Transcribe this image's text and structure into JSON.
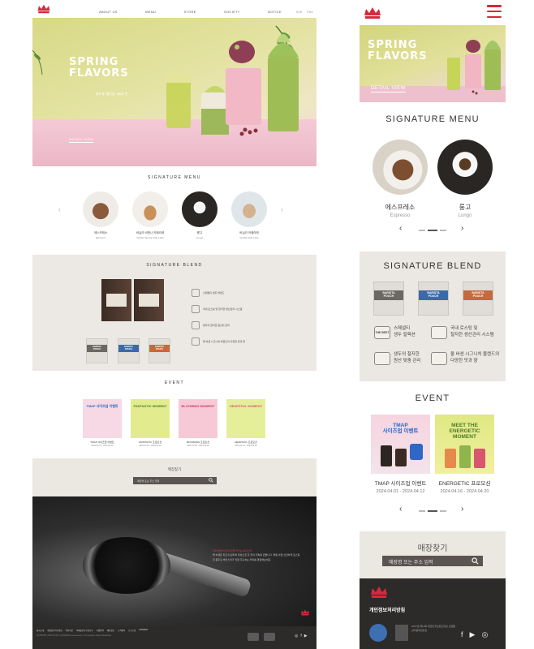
{
  "desktop": {
    "nav": [
      "ABOUT US",
      "MENU",
      "STORE",
      "SOCIETY",
      "NOTICE"
    ],
    "lang": [
      "KOR",
      "ENG"
    ],
    "hero": {
      "title_line1": "SPRING",
      "title_line2": "FLAVORS",
      "subtitle": "봄의 향기를 담은 새로운 맛",
      "detail": "DETAIL VIEW"
    },
    "signature_menu": {
      "title": "SIGNATURE MENU",
      "items": [
        {
          "name": "에스프레소",
          "eng": "Espresso"
        },
        {
          "name": "바닐라 비엔나 카페라떼",
          "eng": "Vanilla Vienna Cafe Latte"
        },
        {
          "name": "룽고",
          "eng": "Lungo"
        },
        {
          "name": "바닐라 카페라떼",
          "eng": "Vanilla Cafe Latte"
        }
      ]
    },
    "signature_blend": {
      "title": "SIGNATURE BLEND",
      "features": [
        "스페셜티 생두 블렌드",
        "국내 로스팅 및 철저한 생산관리 시스템",
        "생두의 철저한 원산지 관리",
        "올 바센 시그니처 블렌드의 다양한 맛과 향"
      ]
    },
    "event": {
      "title": "EVENT",
      "items": [
        {
          "title": "TMAP 사이즈업 이벤트",
          "name": "TMAP 사이즈업 이벤트",
          "date": "2024.04.01 - 2024.04.12"
        },
        {
          "title": "FANTASTIC MOMENT",
          "name": "FANTASTIC 프로모션",
          "date": "2024.03.21 - 2024.04.10"
        },
        {
          "title": "BLOOMING MOMENT",
          "name": "BLOOMING 프로모션",
          "date": "2024.02.26 - 2024.03.20"
        },
        {
          "title": "HEARTFUL MOMENT",
          "name": "HEARTFUL 프로모션",
          "date": "2024.01.18 - 2024.02.25"
        }
      ]
    },
    "store_search": {
      "title": "매장찾기",
      "placeholder": "매장명 또는 주소 입력"
    },
    "brand_text": {
      "highlight": "커피 본연의 맛과 향을 지키는 바리스타",
      "body": "올 바센은 최고의 원두와 정성으로 한 잔의 커피를 만듭니다. 매일 아침 신선하게 로스팅한 원두로 바리스타가 직접 추출하는 커피를 경험해보세요."
    },
    "footer": {
      "links": [
        "회사소개",
        "개인정보처리방침",
        "이용약관",
        "이메일무단수집거부",
        "가맹문의",
        "채용정보",
        "고객센터",
        "오시는길",
        "SITEMAP"
      ],
      "copy": "(주)바센코리아 | 대표이사 홍길동 | 사업자등록번호 000-00-00000 | COPYRIGHT ALL RIGHTS RESERVED.",
      "social": [
        "instagram",
        "facebook",
        "youtube"
      ]
    }
  },
  "mobile": {
    "hero": {
      "title_line1": "SPRING",
      "title_line2": "FLAVORS",
      "detail": "DETAIL VIEW"
    },
    "signature_menu": {
      "title": "SIGNATURE MENU",
      "items": [
        {
          "name": "에스프레소",
          "eng": "Espresso"
        },
        {
          "name": "룽고",
          "eng": "Lungo"
        }
      ]
    },
    "signature_blend": {
      "title": "SIGNATURE BLEND",
      "pouch": [
        "BARISTA",
        "POUCH"
      ],
      "best": "THE BEST",
      "features": [
        {
          "line1": "스페셜티",
          "line2": "생두 컬렉션"
        },
        {
          "line1": "국내 로스팅 및",
          "line2": "철저한 생산관리 시스템"
        },
        {
          "line1": "생두의 철저한",
          "line2": "원산 맞춤 관리"
        },
        {
          "line1": "올 바센 시그니처 블렌드의",
          "line2": "다양한 맛과 향"
        }
      ]
    },
    "event": {
      "title": "EVENT",
      "items": [
        {
          "title_line1": "TMAP",
          "title_line2": "사이즈업 이벤트",
          "name": "TMAP 사이즈업 이벤트",
          "date": "2024.04.01 - 2024.04.12"
        },
        {
          "title_line1": "MEET THE",
          "title_line2": "ENERGETIC",
          "title_line3": "MOMENT",
          "name": "ENERGETIC 프로모션",
          "date": "2024.04.16 - 2024.04.20"
        }
      ]
    },
    "store_search": {
      "title": "매장찾기",
      "placeholder": "매장명 또는 주소 입력"
    },
    "footer": {
      "policy": "개인정보처리방침",
      "award": "2017년 제13회 대한민국브랜드대상 산업통상자원부장관상",
      "social": [
        "facebook",
        "youtube",
        "instagram"
      ]
    }
  },
  "colors": {
    "accent": "#d8283c",
    "hero_bg": "#d7d985",
    "table_pink": "#f2c8d4",
    "blend_bg": "#ebe7e2",
    "footer_bg": "#2d2b29"
  }
}
